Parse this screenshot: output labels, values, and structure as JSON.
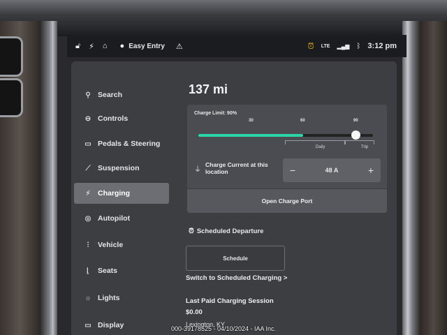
{
  "status_bar": {
    "profile_name": "Easy Entry",
    "network": "LTE",
    "time": "3:12 pm"
  },
  "sidebar": {
    "items": [
      {
        "label": "Search",
        "icon": "search-icon"
      },
      {
        "label": "Controls",
        "icon": "toggle-icon"
      },
      {
        "label": "Pedals & Steering",
        "icon": "car-icon"
      },
      {
        "label": "Suspension",
        "icon": "wrench-icon"
      },
      {
        "label": "Charging",
        "icon": "bolt-icon",
        "active": true
      },
      {
        "label": "Autopilot",
        "icon": "steering-wheel-icon"
      },
      {
        "label": "Vehicle",
        "icon": "sliders-icon"
      },
      {
        "label": "Seats",
        "icon": "seat-icon"
      },
      {
        "label": "Lights",
        "icon": "sun-icon"
      },
      {
        "label": "Display",
        "icon": "display-icon"
      }
    ]
  },
  "charging": {
    "range": "137 mi",
    "charge_limit_label": "Charge Limit: 90%",
    "charge_limit_percent": 90,
    "current_battery_percent": 60,
    "ticks": [
      "30",
      "60",
      "90"
    ],
    "daily_label": "Daily",
    "trip_label": "Trip",
    "current_label": "Charge Current at this location",
    "current_value": "48 A",
    "minus_label": "−",
    "plus_label": "+",
    "open_port_label": "Open Charge Port",
    "accent_color": "#2bd6a8"
  },
  "scheduled": {
    "title": "Scheduled Departure",
    "schedule_button": "Schedule",
    "switch_link": "Switch to Scheduled Charging >"
  },
  "last_session": {
    "title": "Last Paid Charging Session",
    "amount": "$0.00",
    "location": "Lexington, KY"
  },
  "watermark": "000-39178525 - 04/10/2024 - IAA Inc."
}
